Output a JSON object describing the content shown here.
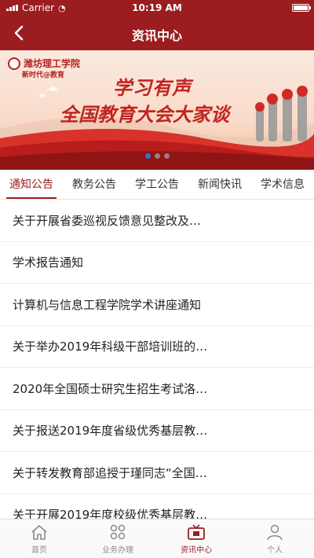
{
  "status": {
    "carrier": "Carrier",
    "time": "10:19 AM"
  },
  "nav": {
    "title": "资讯中心",
    "back_icon": "chevron-left-icon"
  },
  "banner": {
    "logo_name": "潍坊理工学院",
    "logo_sub": "新时代@教育",
    "headline": "学习有声",
    "subheadline": "全国教育大会大家谈",
    "page_count": 3,
    "active_page": 0
  },
  "tabs": [
    {
      "label": "通知公告",
      "active": true
    },
    {
      "label": "教务公告",
      "active": false
    },
    {
      "label": "学工公告",
      "active": false
    },
    {
      "label": "新闻快讯",
      "active": false
    },
    {
      "label": "学术信息",
      "active": false
    }
  ],
  "items": [
    "关于开展省委巡视反馈意见整改及…",
    "学术报告通知",
    "计算机与信息工程学院学术讲座通知",
    "关于举办2019年科级干部培训班的…",
    "2020年全国硕士研究生招生考试洛…",
    "关于报送2019年度省级优秀基层教…",
    "关于转发教育部追授于瑾同志“全国…",
    "关于开展2019年度校级优秀基层教…"
  ],
  "tabbar": [
    {
      "label": "首页",
      "icon": "home-icon",
      "active": false
    },
    {
      "label": "业务办理",
      "icon": "grid-icon",
      "active": false
    },
    {
      "label": "资讯中心",
      "icon": "tv-icon",
      "active": true
    },
    {
      "label": "个人",
      "icon": "person-icon",
      "active": false
    }
  ],
  "colors": {
    "primary": "#9b1d1f",
    "accent": "#c2241f",
    "dot_active": "#2a78d8"
  }
}
